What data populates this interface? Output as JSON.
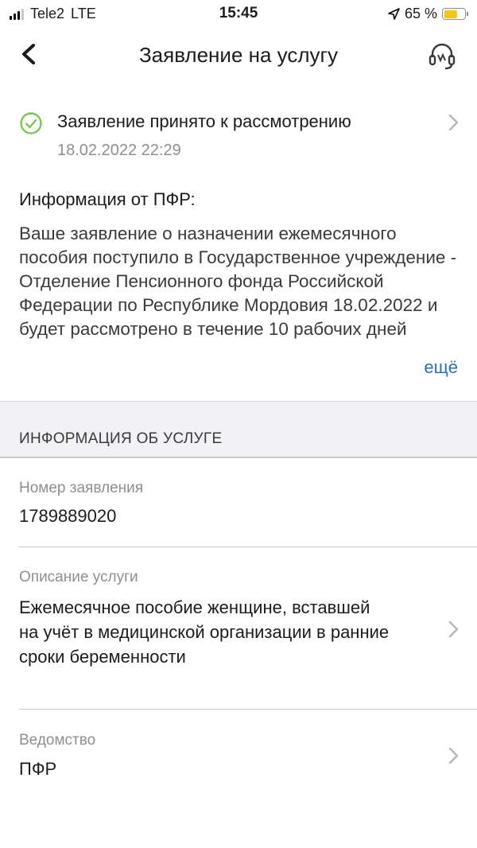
{
  "status_bar": {
    "carrier": "Tele2",
    "network": "LTE",
    "time": "15:45",
    "battery": "65 %",
    "battery_level": 0.65
  },
  "nav": {
    "title": "Заявление на услугу"
  },
  "application_status": {
    "text": "Заявление принято к рассмотрению",
    "date": "18.02.2022 22:29"
  },
  "info": {
    "title": "Информация от ПФР:",
    "body": "Ваше заявление о назначении ежемесячного пособия поступило в Государственное учреждение - Отделение Пенсионного фонда Российской Федерации по Республике Мордовия 18.02.2022 и будет рассмотрено в течение 10 рабочих дней",
    "more": "ещё"
  },
  "service_section": {
    "title": "ИНФОРМАЦИЯ ОБ УСЛУГЕ",
    "fields": [
      {
        "label": "Номер заявления",
        "value": "1789889020"
      },
      {
        "label": "Описание услуги",
        "value": "Ежемесячное пособие женщине, вставшей на учёт в медицинской организации в ранние сроки беременности"
      },
      {
        "label": "Ведомство",
        "value": "ПФР"
      }
    ]
  },
  "colors": {
    "accent_link": "#2e6fb7",
    "success": "#7cc35a",
    "battery": "#f5c518"
  }
}
